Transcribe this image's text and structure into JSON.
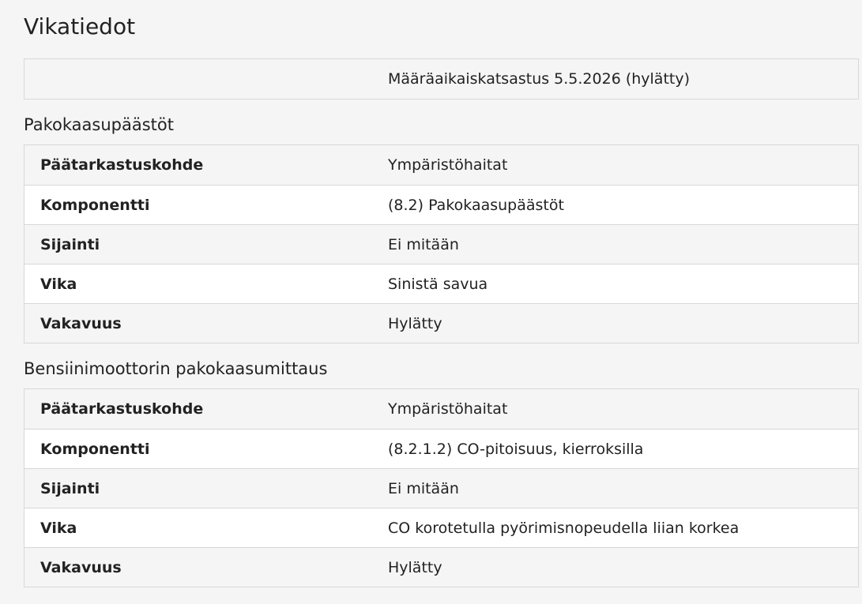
{
  "page_title": "Vikatiedot",
  "inspection": {
    "label": "",
    "value": "Määräaikaiskatsastus 5.5.2026 (hylätty)"
  },
  "sections": [
    {
      "heading": "Pakokaasupäästöt",
      "rows": [
        {
          "label": "Päätarkastuskohde",
          "value": "Ympäristöhaitat"
        },
        {
          "label": "Komponentti",
          "value": "(8.2) Pakokaasupäästöt"
        },
        {
          "label": "Sijainti",
          "value": "Ei mitään"
        },
        {
          "label": "Vika",
          "value": "Sinistä savua"
        },
        {
          "label": "Vakavuus",
          "value": "Hylätty"
        }
      ]
    },
    {
      "heading": "Bensiinimoottorin pakokaasumittaus",
      "rows": [
        {
          "label": "Päätarkastuskohde",
          "value": "Ympäristöhaitat"
        },
        {
          "label": "Komponentti",
          "value": "(8.2.1.2) CO-pitoisuus, kierroksilla"
        },
        {
          "label": "Sijainti",
          "value": "Ei mitään"
        },
        {
          "label": "Vika",
          "value": "CO korotetulla pyörimisnopeudella liian korkea"
        },
        {
          "label": "Vakavuus",
          "value": "Hylätty"
        }
      ]
    }
  ]
}
